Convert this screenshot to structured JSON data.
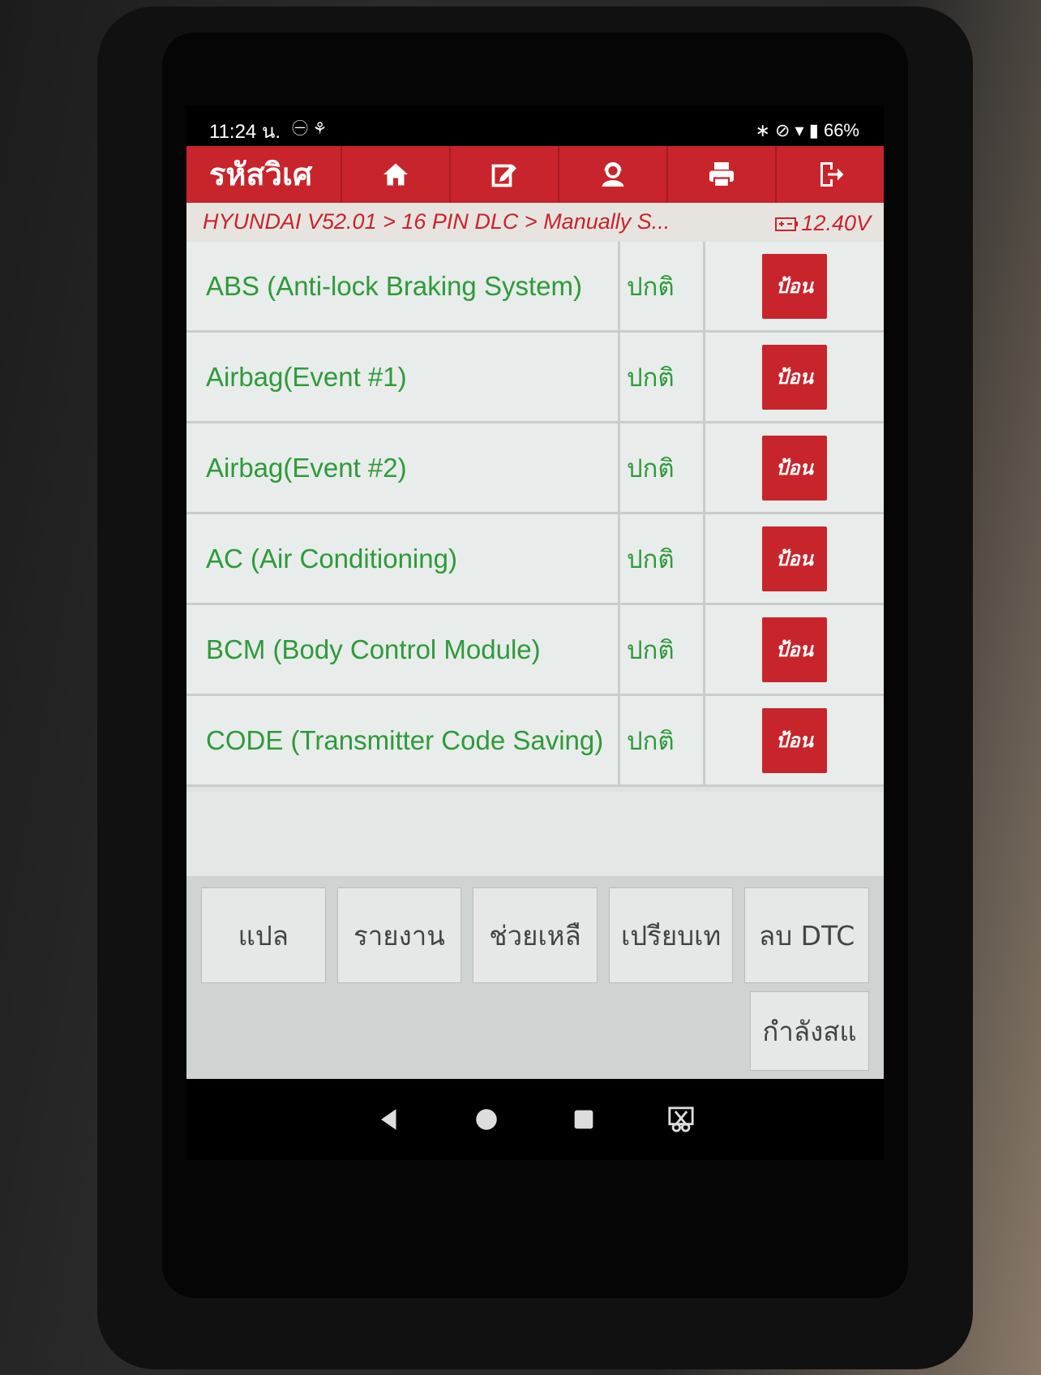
{
  "status_bar": {
    "time": "11:24 น.",
    "left_icons": "㊀ ⚘",
    "right_icons": "∗ ⊘ ▾",
    "battery": "66%"
  },
  "header": {
    "title": "รหัสวิเศ",
    "buttons": [
      "home-icon",
      "edit-icon",
      "support-icon",
      "print-icon",
      "exit-icon"
    ]
  },
  "breadcrumb": {
    "path": "HYUNDAI V52.01 > 16 PIN DLC > Manually S...",
    "voltage": "12.40V"
  },
  "systems": [
    {
      "name": "ABS (Anti-lock Braking System)",
      "status": "ปกติ",
      "action": "ป้อน"
    },
    {
      "name": "Airbag(Event #1)",
      "status": "ปกติ",
      "action": "ป้อน"
    },
    {
      "name": "Airbag(Event #2)",
      "status": "ปกติ",
      "action": "ป้อน"
    },
    {
      "name": "AC (Air Conditioning)",
      "status": "ปกติ",
      "action": "ป้อน"
    },
    {
      "name": "BCM (Body Control Module)",
      "status": "ปกติ",
      "action": "ป้อน"
    },
    {
      "name": "CODE (Transmitter Code Saving)",
      "status": "ปกติ",
      "action": "ป้อน"
    }
  ],
  "toolbar": {
    "buttons": [
      "แปล",
      "รายงาน",
      "ช่วยเหลื",
      "เปรียบเท",
      "ลบ DTC"
    ],
    "extra": "กำลังสแ"
  },
  "colors": {
    "accent_red": "#c8242b",
    "text_green": "#2e9a3a"
  }
}
